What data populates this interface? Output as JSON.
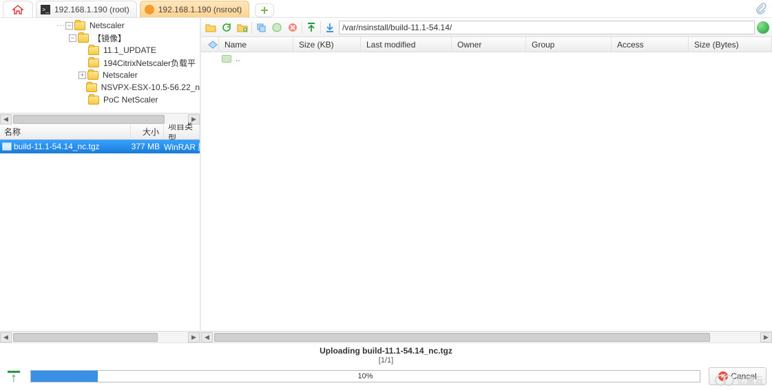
{
  "tabs": {
    "t1_label": "192.168.1.190 (root)",
    "t2_label": "192.168.1.190 (nsroot)"
  },
  "tree": {
    "n0": "Netscaler",
    "n1": "【镜像】",
    "n2": "11.1_UPDATE",
    "n3": "194CitrixNetscaler负载平",
    "n4": "Netscaler",
    "n5": "NSVPX-ESX-10.5-56.22_n",
    "n6": "PoC NetScaler"
  },
  "left_cols": {
    "name": "名称",
    "size": "大小",
    "type": "项目类型"
  },
  "left_row": {
    "name": "build-11.1-54.14_nc.tgz",
    "size": "377 MB",
    "type": "WinRAR 压缩"
  },
  "path": "/var/nsinstall/build-11.1-54.14/",
  "right_cols": {
    "name": "Name",
    "size": "Size (KB)",
    "mod": "Last modified",
    "own": "Owner",
    "grp": "Group",
    "acc": "Access",
    "bytes": "Size (Bytes)"
  },
  "up_entry": "..",
  "status": "Uploading build-11.1-54.14_nc.tgz",
  "count": "[1/1]",
  "progress_pct": "10%",
  "progress_fill_pct": 10,
  "cancel": "Cancel",
  "watermark": "亿速云"
}
